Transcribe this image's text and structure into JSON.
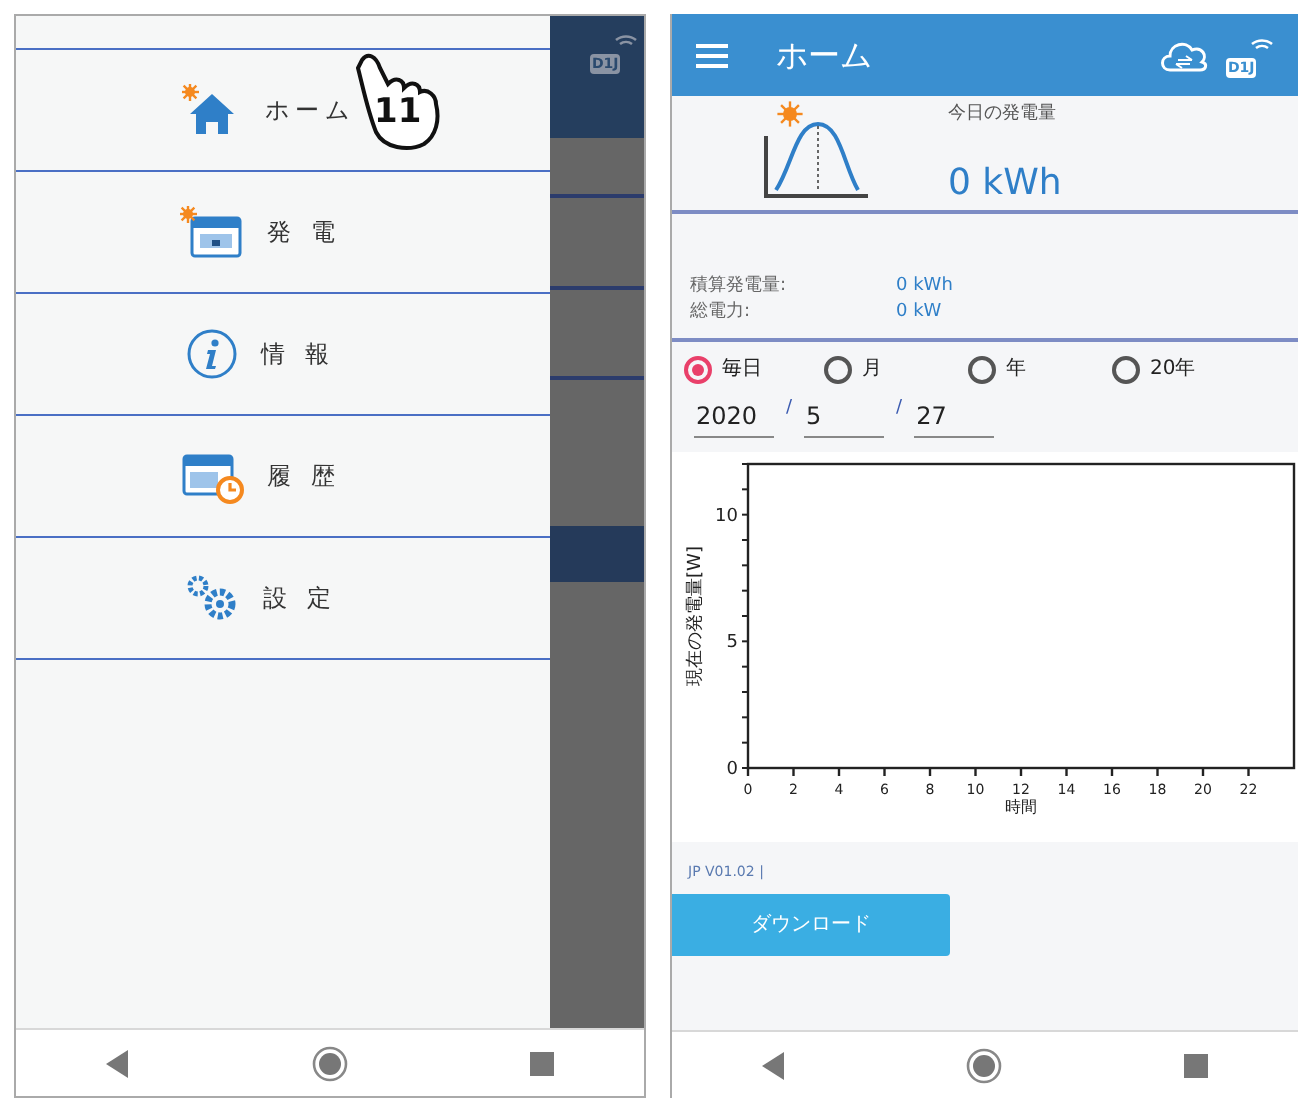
{
  "drawer_screen": {
    "background_header": {
      "badge": "D1J"
    },
    "menu": [
      {
        "label": "ホーム",
        "kind": "home"
      },
      {
        "label": "発 電",
        "kind": "generation"
      },
      {
        "label": "情 報",
        "kind": "info"
      },
      {
        "label": "履 歴",
        "kind": "history"
      },
      {
        "label": "設 定",
        "kind": "settings"
      }
    ],
    "tap_annotation": {
      "label": "11"
    }
  },
  "home_screen": {
    "title": "ホーム",
    "header_badge": "D1J",
    "today": {
      "label": "今日の発電量",
      "value": "0 kWh"
    },
    "stats": [
      {
        "label": "積算発電量:",
        "value": "0 kWh"
      },
      {
        "label": "総電力:",
        "value": "0 kW"
      }
    ],
    "periods": [
      {
        "label": "毎日",
        "selected": true
      },
      {
        "label": "月",
        "selected": false
      },
      {
        "label": "年",
        "selected": false
      },
      {
        "label": "20年",
        "selected": false
      }
    ],
    "date_fields": [
      {
        "value": "2020"
      },
      {
        "separator": "/",
        "value": "5"
      },
      {
        "separator": "/",
        "value": "27"
      }
    ],
    "chart_data": {
      "type": "line",
      "xlabel": "時間",
      "ylabel": "現在の発電量[W]",
      "xlim": [
        0,
        24
      ],
      "ylim": [
        0,
        12
      ],
      "xticks": [
        0,
        2,
        4,
        6,
        8,
        10,
        12,
        14,
        16,
        18,
        20,
        22
      ],
      "yticks": [
        0,
        5,
        10
      ]
    },
    "version": "JP V01.02 |",
    "download_button": "ダウンロード"
  }
}
